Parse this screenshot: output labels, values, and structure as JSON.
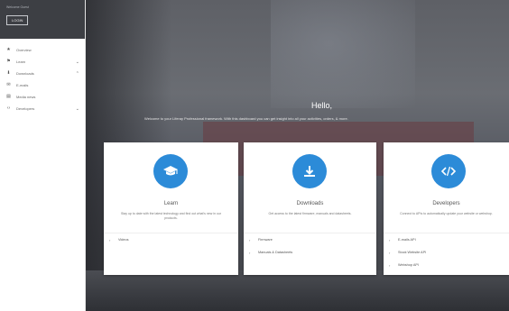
{
  "sidebar": {
    "welcome": "Welcome Guest",
    "login_label": "LOGIN",
    "items": [
      {
        "label": "Overview",
        "icon": "star-icon",
        "glyph": "★",
        "chevron": false
      },
      {
        "label": "Learn",
        "icon": "flag-icon",
        "glyph": "⚑",
        "chevron": true
      },
      {
        "label": "Downloads",
        "icon": "download-icon",
        "glyph": "⬇",
        "chevron": true
      },
      {
        "label": "E-mails",
        "icon": "mail-icon",
        "glyph": "✉",
        "chevron": false
      },
      {
        "label": "Media news",
        "icon": "news-icon",
        "glyph": "▤",
        "chevron": false
      },
      {
        "label": "Developers",
        "icon": "code-icon",
        "glyph": "‹›",
        "chevron": true
      }
    ]
  },
  "hero": {
    "hello": "Hello,",
    "tagline": "Welcome to your Liferay Professional framework. With this dashboard you can get insight into all your activities, orders, & more."
  },
  "cards": [
    {
      "title": "Learn",
      "icon": "graduation-cap-icon",
      "description": "Stay up to date with the latest technology and find out what's new in our products.",
      "links": [
        "Videos"
      ]
    },
    {
      "title": "Downloads",
      "icon": "download-icon",
      "description": "Get access to the latest firmware, manuals and datasheets.",
      "links": [
        "Firmware",
        "Manuals & Datasheets"
      ]
    },
    {
      "title": "Developers",
      "icon": "code-icon",
      "description": "Connect to APIs to automatically update your website or webshop.",
      "links": [
        "E-mails API",
        "Stock Website API",
        "Webshop API"
      ]
    }
  ],
  "colors": {
    "accent": "#2c8bd8",
    "sidebar_head": "#3d3f44"
  }
}
